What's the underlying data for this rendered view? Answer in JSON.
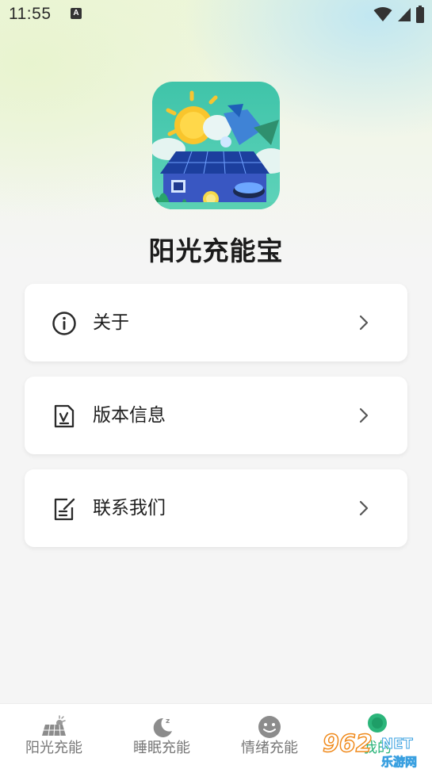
{
  "status_bar": {
    "time": "11:55",
    "notification_letter": "A"
  },
  "app": {
    "name": "阳光充能宝",
    "logo_icon": "solar-panel-house-logo"
  },
  "menu": [
    {
      "label": "关于",
      "icon": "info-icon"
    },
    {
      "label": "版本信息",
      "icon": "version-document-icon"
    },
    {
      "label": "联系我们",
      "icon": "edit-note-icon"
    }
  ],
  "tabs": [
    {
      "label": "阳光充能",
      "icon": "solar-panel-icon"
    },
    {
      "label": "睡眠充能",
      "icon": "moon-sleep-icon"
    },
    {
      "label": "情绪充能",
      "icon": "smiley-face-icon"
    },
    {
      "label": "我的",
      "icon": "profile-icon",
      "active_color": "#2bb57a"
    }
  ],
  "watermark": {
    "number": "962",
    "suffix": "NET",
    "site": "乐游网"
  }
}
